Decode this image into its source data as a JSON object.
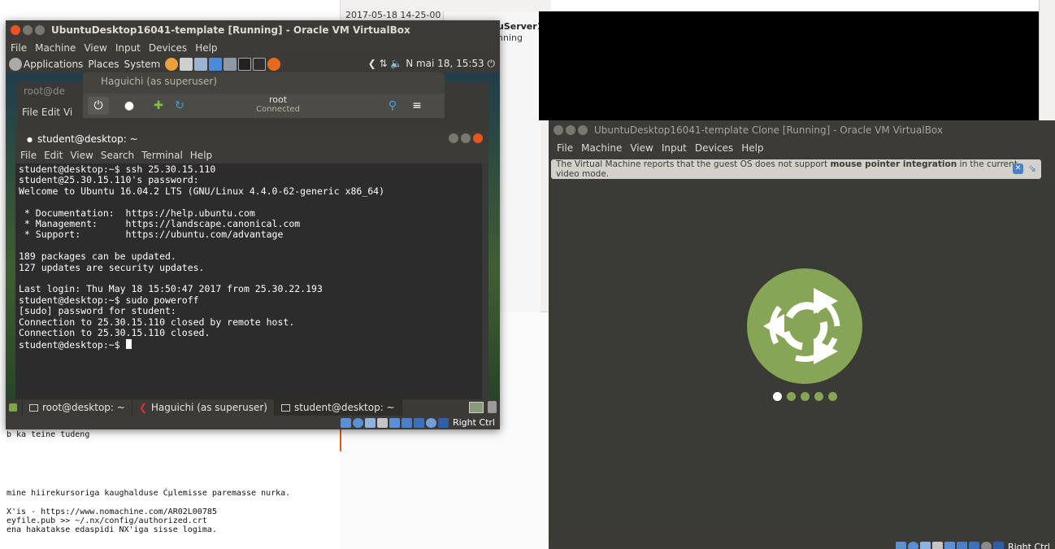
{
  "background": {
    "timestamp": "2017-05-18 14-25-00",
    "server_name": "uServer1",
    "server_status": "nning",
    "doc_lines": [
      "b ka teine tudeng",
      "mine hiirekursoriga kaughalduse Ćµlemisse paremasse nurka.",
      "X'is - https://www.nomachine.com/AR02L00785",
      "eyfile.pub >> ~/.nx/config/authorized.crt",
      "ena hakatakse edaspidi NX'iga sisse logima."
    ]
  },
  "vm1": {
    "title": "UbuntuDesktop16041-template [Running] - Oracle VM VirtualBox",
    "menu": [
      "File",
      "Machine",
      "View",
      "Input",
      "Devices",
      "Help"
    ],
    "guest_panel": {
      "items": [
        "Applications",
        "Places",
        "System"
      ],
      "clock": "N mai  18, 15:53"
    },
    "root_window": {
      "title": "root@de",
      "menu": "File  Edit  Vi"
    },
    "haguichi": {
      "title": "Haguichi (as superuser)",
      "user": "root",
      "status": "Connected"
    },
    "terminal": {
      "title": "student@desktop: ~",
      "menu": [
        "File",
        "Edit",
        "View",
        "Search",
        "Terminal",
        "Help"
      ],
      "lines": [
        "student@desktop:~$ ssh 25.30.15.110",
        "student@25.30.15.110's password:",
        "Welcome to Ubuntu 16.04.2 LTS (GNU/Linux 4.4.0-62-generic x86_64)",
        "",
        " * Documentation:  https://help.ubuntu.com",
        " * Management:     https://landscape.canonical.com",
        " * Support:        https://ubuntu.com/advantage",
        "",
        "189 packages can be updated.",
        "127 updates are security updates.",
        "",
        "Last login: Thu May 18 15:50:47 2017 from 25.30.22.193",
        "student@desktop:~$ sudo poweroff",
        "[sudo] password for student:",
        "Connection to 25.30.15.110 closed by remote host.",
        "Connection to 25.30.15.110 closed."
      ],
      "prompt": "student@desktop:~$ "
    },
    "taskbar": [
      "root@desktop: ~",
      "Haguichi (as superuser)",
      "student@desktop: ~"
    ],
    "host_key": "Right Ctrl"
  },
  "vm2": {
    "title": "UbuntuDesktop16041-template Clone [Running] - Oracle VM VirtualBox",
    "menu": [
      "File",
      "Machine",
      "View",
      "Input",
      "Devices",
      "Help"
    ],
    "notice_pre": "The Virtual Machine reports that the guest OS does not support ",
    "notice_bold": "mouse pointer integration",
    "notice_post": " in the current video mode.",
    "host_key": "Right Ctrl",
    "boot_dots": {
      "count": 5,
      "active_index": 0
    }
  },
  "colors": {
    "ubuntu_mate_green": "#87a556",
    "titlebar": "#3c3b37",
    "close_button": "#e95420"
  }
}
